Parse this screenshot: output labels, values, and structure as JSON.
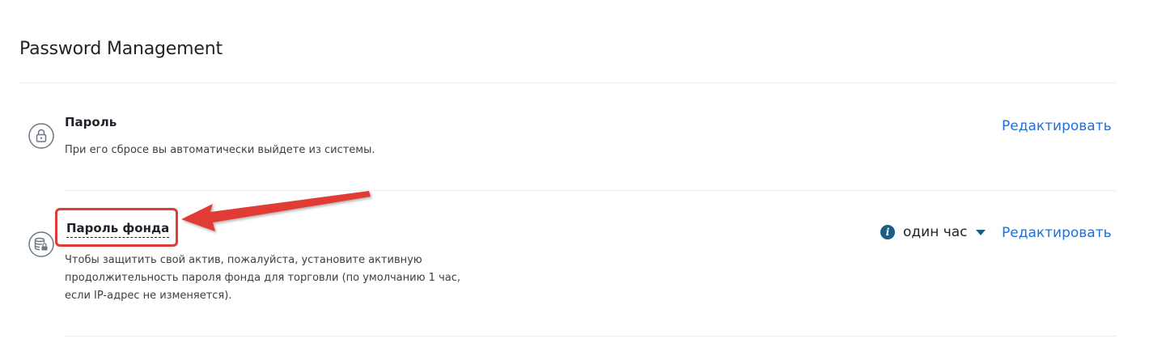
{
  "section": {
    "title": "Password Management"
  },
  "rows": [
    {
      "icon": "lock-icon",
      "title": "Пароль",
      "description": "При его сбросе вы автоматически выйдете из системы.",
      "action_label": "Редактировать"
    },
    {
      "icon": "database-lock-icon",
      "title": "Пароль фонда",
      "description": "Чтобы защитить свой актив, пожалуйста, установите активную продолжительность пароля фонда для торговли (по умолчанию 1 час, если IP-адрес не изменяется).",
      "action_label": "Редактировать",
      "duration": {
        "info_icon": "i",
        "selected": "один час"
      }
    }
  ],
  "colors": {
    "link": "#1e6fd9",
    "annotation": "#e03b36",
    "icon_accent": "#1a5f83"
  }
}
